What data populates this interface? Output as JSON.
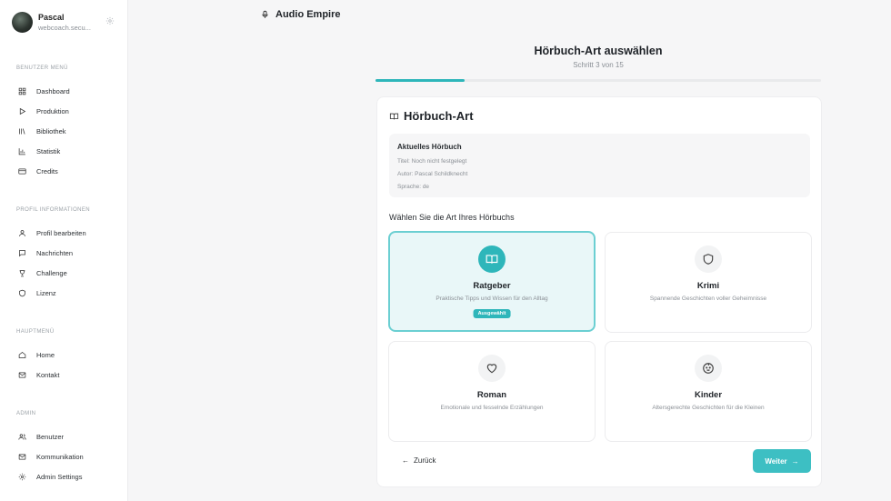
{
  "profile": {
    "name": "Pascal",
    "email": "webcoach.secu..."
  },
  "sidebar": {
    "sections": [
      {
        "label": "BENUTZER MENÜ",
        "items": [
          {
            "label": "Dashboard",
            "icon": "dashboard-icon"
          },
          {
            "label": "Produktion",
            "icon": "play-icon"
          },
          {
            "label": "Bibliothek",
            "icon": "library-icon"
          },
          {
            "label": "Statistik",
            "icon": "chart-icon"
          },
          {
            "label": "Credits",
            "icon": "card-icon"
          }
        ]
      },
      {
        "label": "PROFIL INFORMATIONEN",
        "items": [
          {
            "label": "Profil bearbeiten",
            "icon": "user-icon"
          },
          {
            "label": "Nachrichten",
            "icon": "message-icon"
          },
          {
            "label": "Challenge",
            "icon": "trophy-icon"
          },
          {
            "label": "Lizenz",
            "icon": "shield-icon"
          }
        ]
      },
      {
        "label": "HAUPTMENÜ",
        "items": [
          {
            "label": "Home",
            "icon": "home-icon"
          },
          {
            "label": "Kontakt",
            "icon": "mail-icon"
          }
        ]
      },
      {
        "label": "ADMIN",
        "items": [
          {
            "label": "Benutzer",
            "icon": "users-icon"
          },
          {
            "label": "Kommunikation",
            "icon": "mail-icon"
          },
          {
            "label": "Admin Settings",
            "icon": "gear-icon"
          }
        ]
      }
    ]
  },
  "brand": {
    "title": "Audio Empire"
  },
  "wizard": {
    "title": "Hörbuch-Art auswählen",
    "step_text": "Schritt 3 von 15",
    "progress": 0.2
  },
  "card": {
    "title": "Hörbuch-Art",
    "current": {
      "heading": "Aktuelles Hörbuch",
      "title_line": "Titel: Noch nicht festgelegt",
      "author_line": "Autor: Pascal Schildknecht",
      "language_line": "Sprache: de"
    },
    "prompt": "Wählen Sie die Art Ihres Hörbuchs",
    "options": [
      {
        "title": "Ratgeber",
        "desc": "Praktische Tipps und Wissen für den Alltag",
        "badge": "Ausgewählt",
        "icon": "book-icon"
      },
      {
        "title": "Krimi",
        "desc": "Spannende Geschichten voller Geheimnisse",
        "icon": "shield-icon"
      },
      {
        "title": "Roman",
        "desc": "Emotionale und fesselnde Erzählungen",
        "icon": "heart-icon"
      },
      {
        "title": "Kinder",
        "desc": "Altersgerechte Geschichten für die Kleinen",
        "icon": "baby-icon"
      }
    ],
    "back_label": "Zurück",
    "next_label": "Weiter"
  },
  "colors": {
    "accent": "#2eb6ba",
    "selected_bg": "#e9f7f8"
  }
}
